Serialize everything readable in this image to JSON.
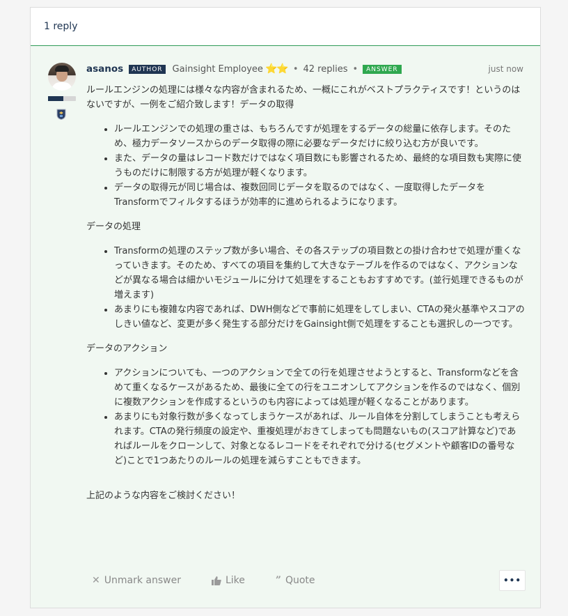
{
  "header": {
    "reply_count": "1 reply"
  },
  "post": {
    "username": "asanos",
    "author_tag": "AUTHOR",
    "rank_title": "Gainsight Employee",
    "stars": "⭐⭐",
    "replies": "42 replies",
    "answer_tag": "ANSWER",
    "timestamp": "just now",
    "rank_progress": 0.55,
    "intro": "ルールエンジンの処理には様々な内容が含まれるため、一概にこれがベストプラクティスです！というのはないですが、一例をご紹介致します！データの取得",
    "list1": [
      "ルールエンジンでの処理の重さは、もちろんですが処理をするデータの総量に依存します。そのため、極力データソースからのデータ取得の際に必要なデータだけに絞り込む方が良いです。",
      "また、データの量はレコード数だけではなく項目数にも影響されるため、最終的な項目数も実際に使うものだけに制限する方が処理が軽くなります。",
      "データの取得元が同じ場合は、複数回同じデータを取るのではなく、一度取得したデータをTransformでフィルタするほうが効率的に進められるようになります。"
    ],
    "section2": "データの処理",
    "list2": [
      "Transformの処理のステップ数が多い場合、その各ステップの項目数との掛け合わせで処理が重くなっていきます。そのため、すべての項目を集約して大きなテーブルを作るのではなく、アクションなどが異なる場合は細かいモジュールに分けて処理をすることもおすすめです。(並行処理できるものが増えます)",
      "あまりにも複雑な内容であれば、DWH側などで事前に処理をしてしまい、CTAの発火基準やスコアのしきい値など、変更が多く発生する部分だけをGainsight側で処理をすることも選択しの一つです。"
    ],
    "section3": "データのアクション",
    "list3": [
      "アクションについても、一つのアクションで全ての行を処理させようとすると、Transformなどを含めて重くなるケースがあるため、最後に全ての行をユニオンしてアクションを作るのではなく、個別に複数アクションを作成するというのも内容によっては処理が軽くなることがあります。",
      "あまりにも対象行数が多くなってしまうケースがあれば、ルール自体を分割してしまうことも考えられます。CTAの発行頻度の設定や、重複処理がおきてしまっても問題ないもの(スコア計算など)であればルールをクローンして、対象となるレコードをそれぞれで分ける(セグメントや顧客IDの番号など)ことで1つあたりのルールの処理を減らすこともできます。"
    ],
    "closing": "上記のような内容をご検討ください！"
  },
  "actions": {
    "unmark_label": "Unmark answer",
    "like_label": "Like",
    "quote_label": "Quote",
    "more_label": "•••"
  },
  "colors": {
    "brand_navy": "#1f3552",
    "answer_green": "#2fa84f",
    "reply_bg": "#f1f8f2",
    "divider_green": "#2f9a57"
  }
}
